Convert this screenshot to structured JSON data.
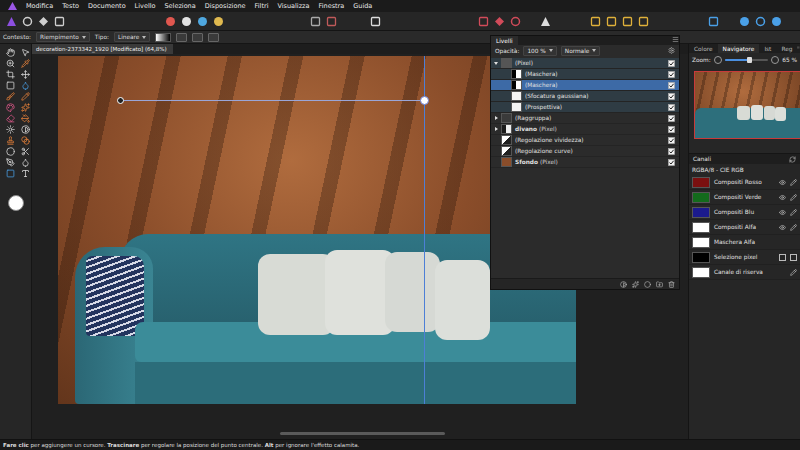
{
  "window": {
    "title": "decoration-2373342_1920 [Modificato] (64,8%)"
  },
  "menu": [
    "Modifica",
    "Testo",
    "Documento",
    "Livello",
    "Seleziona",
    "Disposizione",
    "Filtri",
    "Visualizza",
    "Finestra",
    "Guida"
  ],
  "context_toolbar": {
    "label": "Contesto:",
    "fill": "Riempimento",
    "type_label": "Tipo:",
    "type_value": "Lineare"
  },
  "layers_panel": {
    "tabs": [
      {
        "label": "Livelli",
        "selected": true
      }
    ],
    "opacity_label": "Opacità:",
    "opacity": "100 %",
    "blend_mode": "Normale",
    "layers": [
      {
        "name": "(Pixel)",
        "bold": false,
        "depth": 0,
        "kind": "pixel",
        "has_children": true,
        "expanded": true,
        "selected": false,
        "visible": true
      },
      {
        "name": "(Maschera)",
        "bold": false,
        "depth": 1,
        "kind": "mask",
        "has_children": false,
        "expanded": false,
        "selected": false,
        "visible": true
      },
      {
        "name": "(Maschera)",
        "bold": false,
        "depth": 1,
        "kind": "mask",
        "has_children": false,
        "expanded": false,
        "selected": true,
        "visible": true
      },
      {
        "name": "(Sfocatura gaussiana)",
        "bold": false,
        "depth": 1,
        "kind": "filter",
        "has_children": false,
        "expanded": false,
        "selected": false,
        "visible": true
      },
      {
        "name": "(Prospettiva)",
        "bold": false,
        "depth": 1,
        "kind": "filter",
        "has_children": false,
        "expanded": false,
        "selected": false,
        "visible": true
      },
      {
        "name": "(Raggruppa)",
        "bold": false,
        "depth": 0,
        "kind": "group",
        "has_children": true,
        "expanded": false,
        "selected": false,
        "visible": true
      },
      {
        "name": "divano",
        "bold": true,
        "detail": "(Pixel)",
        "depth": 0,
        "kind": "masked",
        "has_children": true,
        "expanded": false,
        "selected": false,
        "visible": true
      },
      {
        "name": "(Regolazione vividezza)",
        "bold": false,
        "depth": 0,
        "kind": "adjustment",
        "has_children": false,
        "expanded": false,
        "selected": false,
        "visible": true
      },
      {
        "name": "(Regolazione curve)",
        "bold": false,
        "depth": 0,
        "kind": "adjustment",
        "has_children": false,
        "expanded": false,
        "selected": false,
        "visible": true
      },
      {
        "name": "Sfondo",
        "bold": true,
        "detail": "(Pixel)",
        "depth": 0,
        "kind": "image",
        "has_children": false,
        "expanded": false,
        "selected": false,
        "visible": true
      }
    ]
  },
  "navigator_panel": {
    "tabs": [
      {
        "label": "Colore",
        "selected": false
      },
      {
        "label": "Navigatore",
        "selected": true
      },
      {
        "label": "Ist",
        "selected": false
      },
      {
        "label": "Reg",
        "selected": false
      }
    ],
    "zoom_label": "Zoom:",
    "zoom": "65 %",
    "level": 0.55
  },
  "channels_panel": {
    "title": "Canali",
    "mode": "RGBA/8 - CIE RGB",
    "channels": [
      {
        "name": "Compositi Rosso",
        "kind": "composite",
        "color": "#7a1010"
      },
      {
        "name": "Compositi Verde",
        "kind": "composite",
        "color": "#136b1c"
      },
      {
        "name": "Compositi Blu",
        "kind": "composite",
        "color": "#1b1a8c"
      },
      {
        "name": "Compositi Alfa",
        "kind": "composite",
        "color": "#ffffff"
      },
      {
        "name": "Maschera Alfa",
        "kind": "mask",
        "color": "#ffffff"
      },
      {
        "name": "Selezione pixel",
        "kind": "selection",
        "color": "#000000"
      },
      {
        "name": "Canale di riserva",
        "kind": "spare",
        "color": "#ffffff"
      }
    ]
  },
  "status_bar": {
    "segments": [
      {
        "text": "Fare clic",
        "bold": true
      },
      {
        "text": " per aggiungere un cursore. ",
        "bold": false
      },
      {
        "text": "Trascinare",
        "bold": true
      },
      {
        "text": " per regolare la posizione del punto centrale. ",
        "bold": false
      },
      {
        "text": "Alt",
        "bold": true
      },
      {
        "text": " per ignorare l'effetto calamita.",
        "bold": false
      }
    ]
  }
}
